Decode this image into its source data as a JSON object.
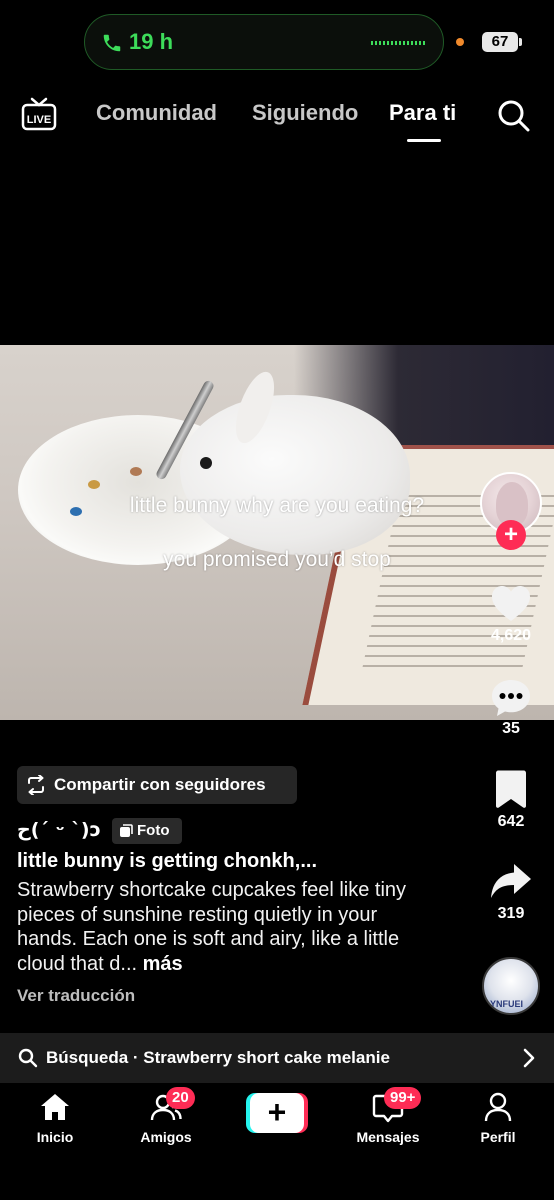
{
  "status_bar": {
    "call_time": "19 h",
    "battery": "67"
  },
  "top_nav": {
    "live_label": "LIVE",
    "tabs": [
      {
        "label": "Comunidad",
        "active": false
      },
      {
        "label": "Siguiendo",
        "active": false
      },
      {
        "label": "Para ti",
        "active": true
      }
    ]
  },
  "post": {
    "overlay_lines": [
      "little bunny why are you eating?",
      "you promised you’d stop"
    ],
    "share_label": "Compartir con seguidores",
    "username": "ح(ˊ ᵕ ˋ)ɔ",
    "type_badge": "Foto",
    "title": "little bunny is getting chonkh,...",
    "description": "Strawberry shortcake cupcakes feel like tiny pieces of sunshine resting quietly in your hands. Each one is soft and airy, like a little cloud that d...",
    "more_label": "más",
    "translate_label": "Ver traducción",
    "music_disc_text": "YNFUEI"
  },
  "actions": {
    "follow_plus": "+",
    "likes": "4,620",
    "comments": "35",
    "saves": "642",
    "shares": "319"
  },
  "search_suggestion": {
    "prefix": "Búsqueda",
    "separator": "·",
    "query": "Strawberry short cake melanie",
    "full": "Búsqueda · Strawberry short cake melanie"
  },
  "bottom_nav": {
    "items": [
      {
        "label": "Inicio",
        "icon": "home-icon",
        "badge": ""
      },
      {
        "label": "Amigos",
        "icon": "friends-icon",
        "badge": "20"
      },
      {
        "label": "",
        "icon": "create-icon",
        "badge": ""
      },
      {
        "label": "Mensajes",
        "icon": "inbox-icon",
        "badge": "99+"
      },
      {
        "label": "Perfil",
        "icon": "profile-icon",
        "badge": ""
      }
    ],
    "create_symbol": "+"
  },
  "colors": {
    "accent": "#fe2c55",
    "cyan": "#25f4ee",
    "call_green": "#3ddc5a"
  }
}
